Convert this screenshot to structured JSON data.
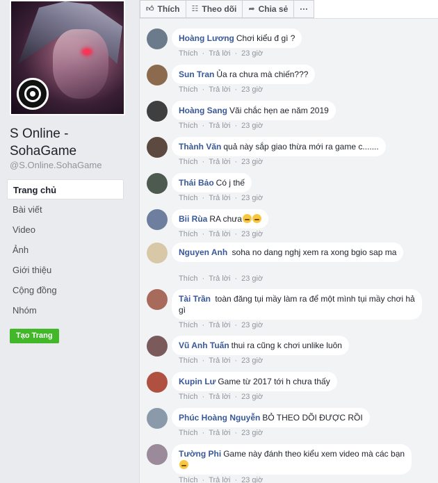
{
  "sidebar": {
    "page_name": "S Online - SohaGame",
    "page_handle": "@S.Online.SohaGame",
    "nav": [
      {
        "label": "Trang chủ",
        "active": true
      },
      {
        "label": "Bài viết"
      },
      {
        "label": "Video"
      },
      {
        "label": "Ảnh"
      },
      {
        "label": "Giới thiệu"
      },
      {
        "label": "Cộng đồng"
      },
      {
        "label": "Nhóm"
      }
    ],
    "create_page": "Tạo Trang"
  },
  "actions": {
    "like": "Thích",
    "follow": "Theo dõi",
    "share": "Chia sẻ",
    "more": "···"
  },
  "comment_meta": {
    "like": "Thích",
    "reply": "Trả lời",
    "time": "23 giờ"
  },
  "comments": [
    {
      "author": "Hoàng Lương",
      "text": "Chơi kiểu đ   gì ?",
      "avatar_color": "#6b7b8c"
    },
    {
      "author": "Sun Tran",
      "text": "Ủa ra chưa mà chiến???",
      "avatar_color": "#8c6a4e"
    },
    {
      "author": "Hoàng Sang",
      "text": "Vãi chắc hẹn ae năm 2019",
      "avatar_color": "#3f3f3f"
    },
    {
      "author": "Thành Văn",
      "text": "quả này sắp giao thừa mới ra game c.......",
      "avatar_color": "#5c4a40"
    },
    {
      "author": "Thái Bảo",
      "text": "Có j thế",
      "avatar_color": "#4d5a4f"
    },
    {
      "author": "Bii Rùa",
      "text": "RA chưa",
      "avatar_color": "#6e7e9e",
      "emojis": 2
    },
    {
      "author": "Nguyen Anh",
      "text": "  soha no dang nghj xem ra xong bgio sap ma",
      "avatar_color": "#d8c8a8"
    },
    {
      "author": "Tài Trần",
      "text": "  toàn đăng tụi mầy làm ra để một mình tụi mầy chơi hả gì",
      "avatar_color": "#a86a5a"
    },
    {
      "author": "Vũ Anh Tuấn",
      "text": "thui ra cũng k chơi unlike luôn",
      "avatar_color": "#7a5a5a"
    },
    {
      "author": "Kupin Lư",
      "text": "Game từ 2017 tới h chưa thấy",
      "avatar_color": "#b05040"
    },
    {
      "author": "Phúc Hoàng Nguyễn",
      "text": "BỎ THEO DÕI ĐƯỢC RỒI",
      "avatar_color": "#8a9aaa"
    },
    {
      "author": "Tường Phi",
      "text": "Game này đánh theo kiểu xem video mà các bạn",
      "avatar_color": "#9a8a9a",
      "trailing_emoji": true
    }
  ]
}
